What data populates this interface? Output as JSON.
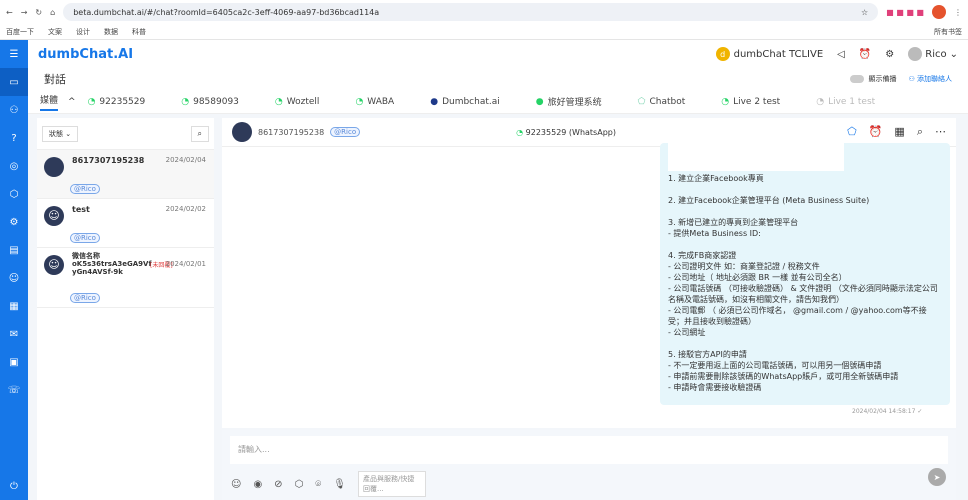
{
  "browser": {
    "url": "beta.dumbchat.ai/#/chat?roomId=6405ca2c-3eff-4069-aa97-bd36bcad114a",
    "bookmarks": [
      "百度一下",
      "文案",
      "设计",
      "数据",
      "科普"
    ],
    "all_bookmarks": "所有书签"
  },
  "header": {
    "logo": "dumbChat.AI",
    "workspace": "dumbChat TCLIVE",
    "workspace_initial": "d",
    "user": "Rico"
  },
  "page": {
    "title": "對話",
    "toggle_label": "顯示備播",
    "add_contact": "添加聯絡人"
  },
  "tabs": [
    {
      "label": "媒體"
    },
    {
      "label": "92235529",
      "icon": "whatsapp"
    },
    {
      "label": "98589093",
      "icon": "whatsapp"
    },
    {
      "label": "Woztell",
      "icon": "whatsapp"
    },
    {
      "label": "WABA",
      "icon": "whatsapp"
    },
    {
      "label": "Dumbchat.ai",
      "icon": "facebook"
    },
    {
      "label": "旅好管理系统",
      "icon": "wechat"
    },
    {
      "label": "Chatbot",
      "icon": "bot"
    },
    {
      "label": "Live 2 test",
      "icon": "whatsapp"
    },
    {
      "label": "Live 1 test",
      "icon": "whatsapp"
    }
  ],
  "list": {
    "filter": "狀態",
    "items": [
      {
        "name": "8617307195238",
        "date": "2024/02/04",
        "tag": "@Rico"
      },
      {
        "name": "test",
        "date": "2024/02/02",
        "tag": "@Rico"
      },
      {
        "name": "微信名称\noK5s36trsA3eGA9Vf\nyGn4AVSf-9k",
        "badge": "[未回覆]",
        "date": "2024/02/01",
        "tag": "@Rico"
      }
    ]
  },
  "chat": {
    "contact": "8617307195238",
    "tag": "@Rico",
    "channel": "92235529 (WhatsApp)",
    "message": "1. 建立企業Facebook專頁\n\n2. 建立Facebook企業管理平台 (Meta Business Suite)\n\n3. 新增已建立的專頁到企業管理平台\n- 提供Meta Business ID:\n\n4. 完成FB商家認證\n- 公司證明文件 如：商業登記證 / 稅務文件\n- 公司地址（ 地址必須跟 BR 一樣 並有公司全名）\n- 公司電話號碼 （可接收驗證碼） & 文件證明 （文件必須同時顯示法定公司名稱及電話號碼，如沒有相關文件，請告知我們）\n- 公司電郵 （ 必須已公司作域名， @gmail.com / @yahoo.com等不接受；并且接收到驗證碼）\n- 公司網址\n\n5. 接駁官方API的申請\n- 不一定要用返上面的公司電話號碼，可以用另一個號碼申請\n- 申請前需要刪除該號碼的WhatsApp賬戶，或可用全新號碼申請\n- 申請時會需要接收驗證碼",
    "time": "2024/02/04 14:58:17"
  },
  "composer": {
    "placeholder": "請輸入...",
    "search_placeholder": "產品與服務/快捷回覆..."
  }
}
